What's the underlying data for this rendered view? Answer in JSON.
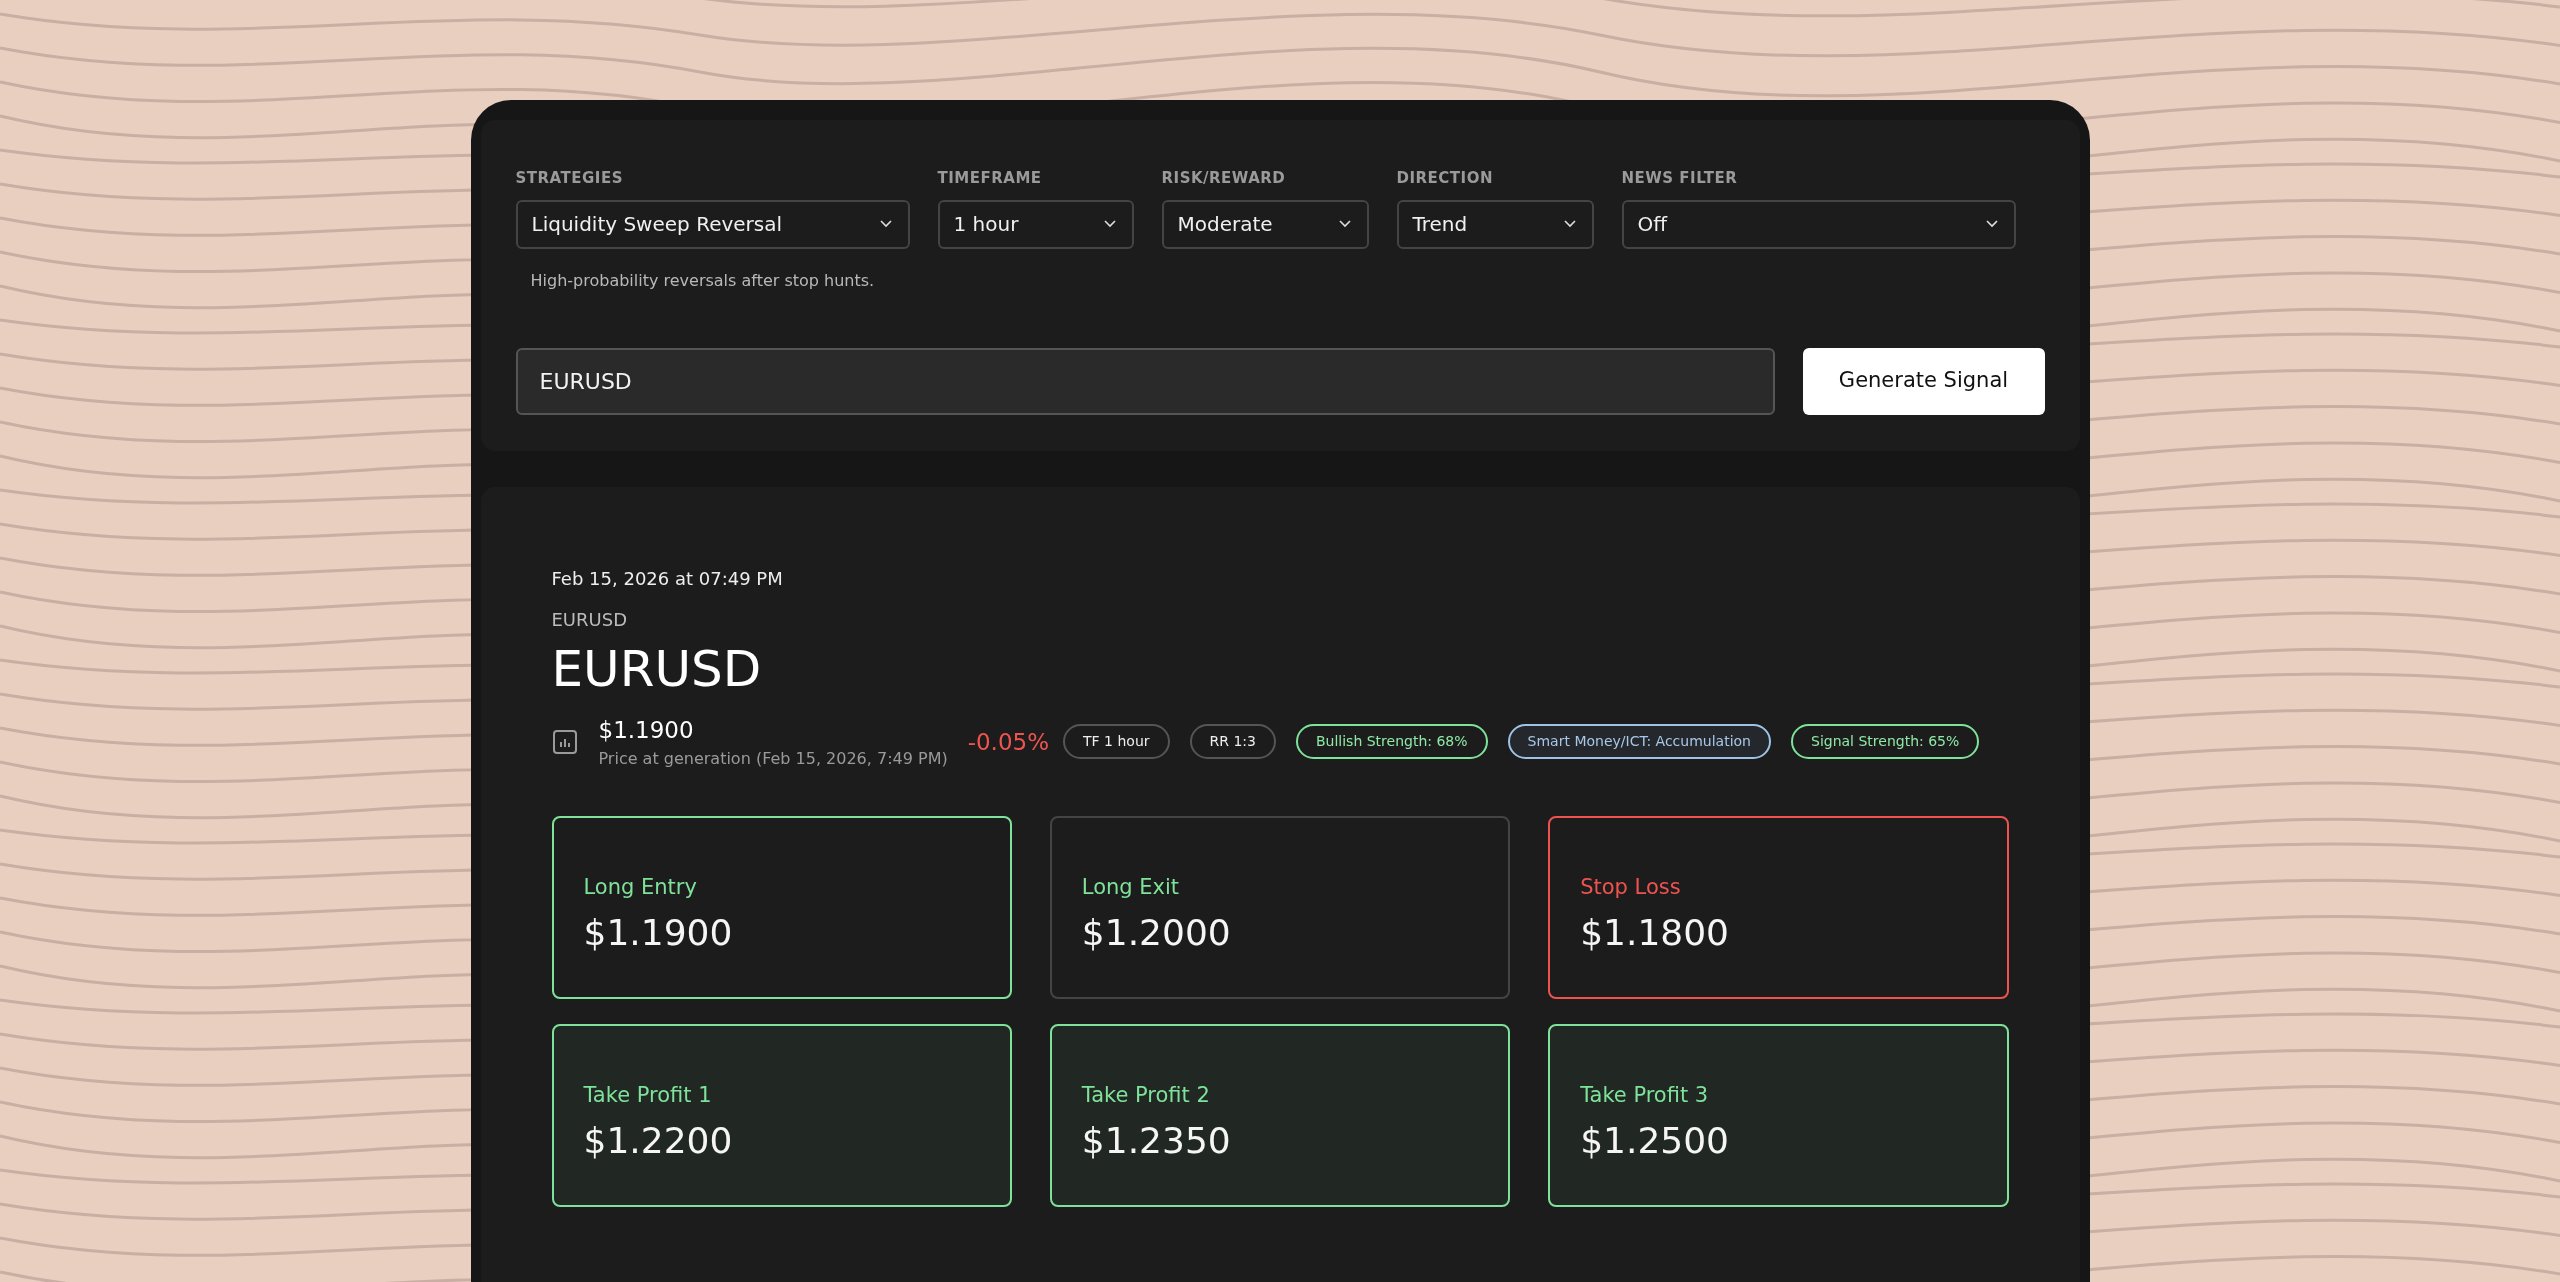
{
  "filters": [
    {
      "label": "STRATEGIES",
      "value": "Liquidity Sweep Reversal"
    },
    {
      "label": "TIMEFRAME",
      "value": "1 hour"
    },
    {
      "label": "RISK/REWARD",
      "value": "Moderate"
    },
    {
      "label": "DIRECTION",
      "value": "Trend"
    },
    {
      "label": "NEWS FILTER",
      "value": "Off"
    }
  ],
  "strategy_hint": "High-probability reversals after stop hunts.",
  "symbol_input": {
    "value": "EURUSD"
  },
  "generate_button": "Generate Signal",
  "result": {
    "timestamp": "Feb 15, 2026 at 07:49 PM",
    "symbol_label": "EURUSD",
    "symbol_title": "EURUSD",
    "price": "$1.1900",
    "price_caption": "Price at generation (Feb 15, 2026, 7:49 PM)",
    "change": {
      "text": "-0.05%",
      "negative": true
    },
    "chips": [
      {
        "text": "TF 1 hour",
        "kind": "neutral"
      },
      {
        "text": "RR 1:3",
        "kind": "neutral"
      },
      {
        "text": "Bullish Strength: 68%",
        "kind": "bullish"
      },
      {
        "text": "Smart Money/ICT: Accumulation",
        "kind": "info"
      },
      {
        "text": "Signal Strength: 65%",
        "kind": "bullish"
      }
    ],
    "levels": [
      {
        "label": "Long Entry",
        "value": "$1.1900",
        "kind": "entry"
      },
      {
        "label": "Long Exit",
        "value": "$1.2000",
        "kind": "exit"
      },
      {
        "label": "Stop Loss",
        "value": "$1.1800",
        "kind": "stop"
      },
      {
        "label": "Take Profit 1",
        "value": "$1.2200",
        "kind": "target"
      },
      {
        "label": "Take Profit 2",
        "value": "$1.2350",
        "kind": "target"
      },
      {
        "label": "Take Profit 3",
        "value": "$1.2500",
        "kind": "target"
      }
    ]
  }
}
